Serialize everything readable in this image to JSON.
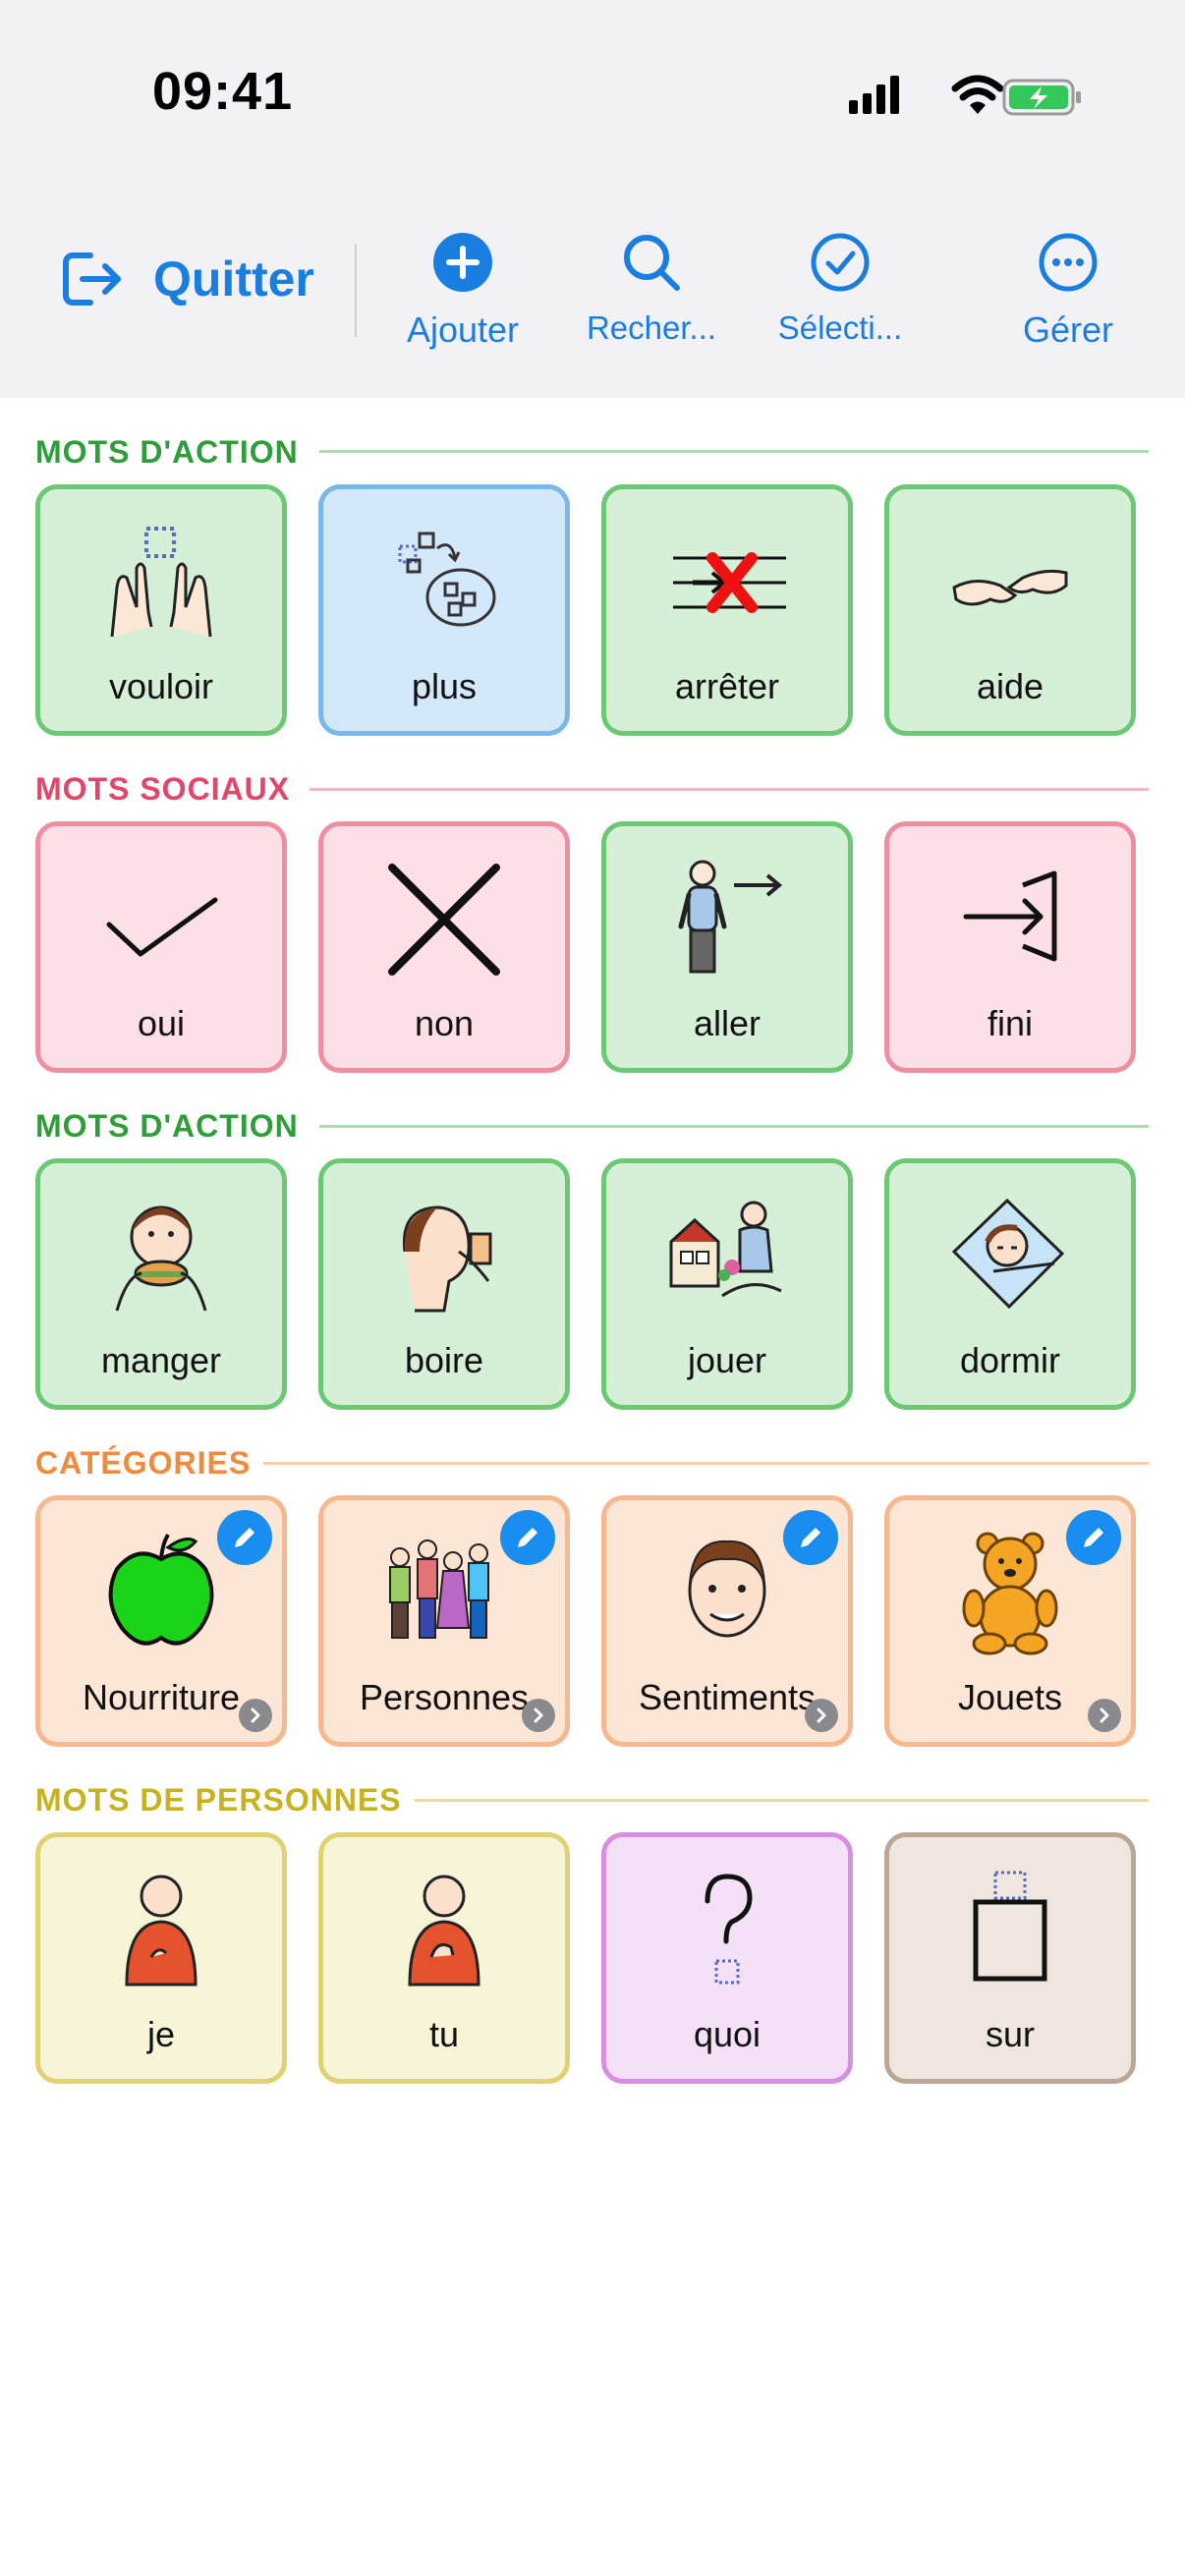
{
  "status": {
    "time": "09:41"
  },
  "toolbar": {
    "quit_label": "Quitter",
    "add_label": "Ajouter",
    "search_label": "Recher...",
    "select_label": "Sélecti...",
    "manage_label": "Gérer"
  },
  "colors": {
    "accent": "#1a7de0",
    "action_heading": "#2f9e3a",
    "social_heading": "#e0476a",
    "categories_heading": "#f08a3c",
    "people_heading": "#c8b21e"
  },
  "sections": [
    {
      "title": "MOTS D'ACTION",
      "tiles": [
        {
          "word": "vouloir",
          "color": "green",
          "icon": "want-hands-icon"
        },
        {
          "word": "plus",
          "color": "blue",
          "icon": "more-icon"
        },
        {
          "word": "arrêter",
          "color": "green",
          "icon": "stop-icon"
        },
        {
          "word": "aide",
          "color": "green",
          "icon": "help-hands-icon"
        }
      ]
    },
    {
      "title": "MOTS SOCIAUX",
      "tiles": [
        {
          "word": "oui",
          "color": "pink",
          "icon": "checkmark-icon"
        },
        {
          "word": "non",
          "color": "pink",
          "icon": "x-icon"
        },
        {
          "word": "aller",
          "color": "green",
          "icon": "go-person-icon"
        },
        {
          "word": "fini",
          "color": "pink",
          "icon": "finished-icon"
        }
      ]
    },
    {
      "title": "MOTS D'ACTION",
      "tiles": [
        {
          "word": "manger",
          "color": "green",
          "icon": "eat-icon"
        },
        {
          "word": "boire",
          "color": "green",
          "icon": "drink-icon"
        },
        {
          "word": "jouer",
          "color": "green",
          "icon": "play-icon"
        },
        {
          "word": "dormir",
          "color": "green",
          "icon": "sleep-icon"
        }
      ]
    },
    {
      "title": "CATÉGORIES",
      "tiles": [
        {
          "word": "Nourriture",
          "color": "peach",
          "icon": "apple-icon"
        },
        {
          "word": "Personnes",
          "color": "peach",
          "icon": "people-group-icon"
        },
        {
          "word": "Sentiments",
          "color": "peach",
          "icon": "face-icon"
        },
        {
          "word": "Jouets",
          "color": "peach",
          "icon": "teddy-bear-icon"
        }
      ]
    },
    {
      "title": "MOTS DE PERSONNES",
      "tiles": [
        {
          "word": "je",
          "color": "yellow",
          "icon": "me-person-icon"
        },
        {
          "word": "tu",
          "color": "yellow",
          "icon": "you-person-icon"
        },
        {
          "word": "quoi",
          "color": "purple",
          "icon": "question-icon"
        },
        {
          "word": "sur",
          "color": "tan",
          "icon": "on-box-icon"
        }
      ]
    }
  ]
}
